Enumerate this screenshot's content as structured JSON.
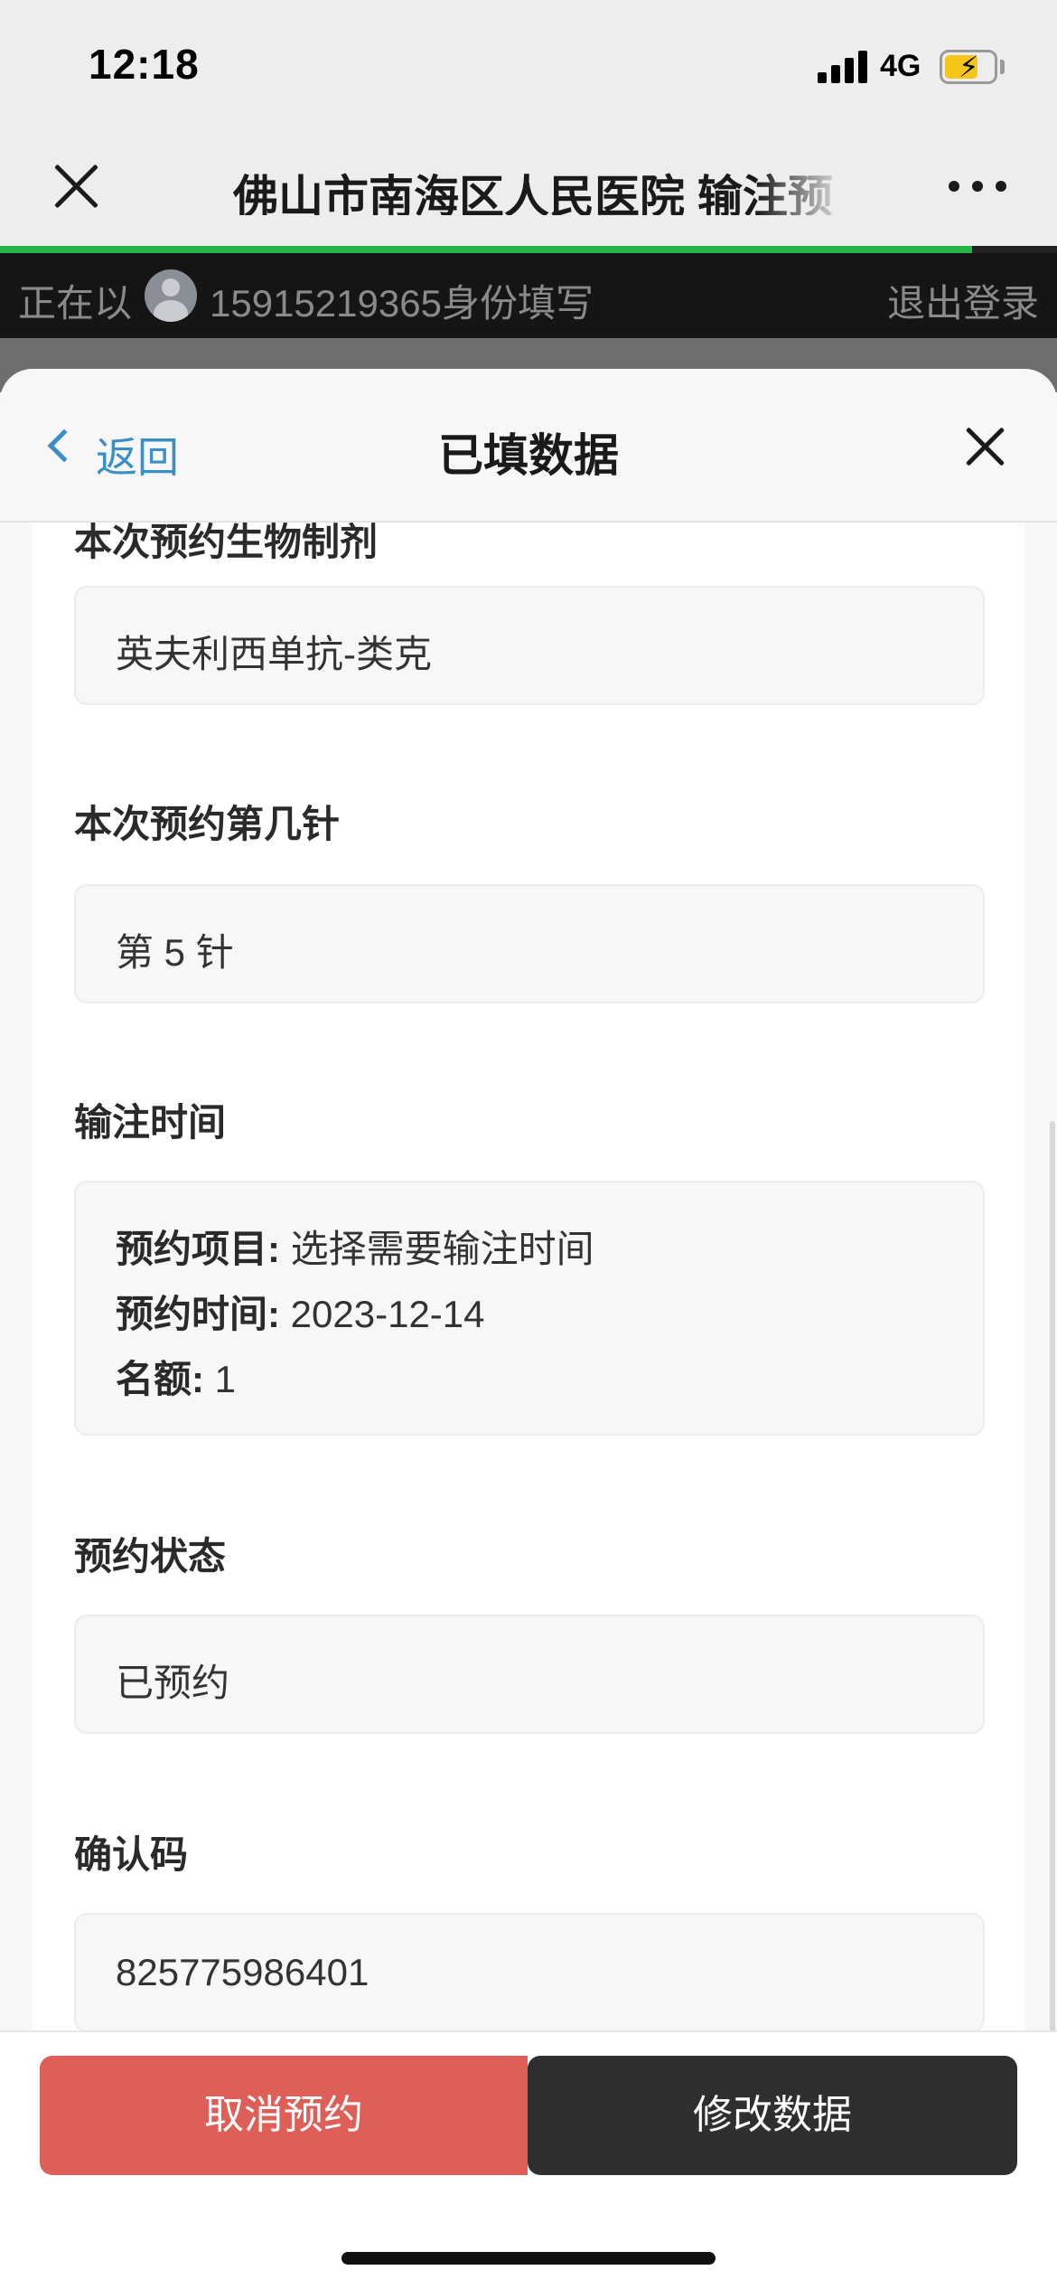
{
  "status_bar": {
    "time": "12:18",
    "network": "4G",
    "battery_icon": "battery-charging-icon",
    "signal_icon": "signal-icon"
  },
  "nav": {
    "title": "佛山市南海区人民医院  输注预",
    "close_icon": "close-icon",
    "more_icon": "more-icon"
  },
  "progress": {
    "fraction": 0.92,
    "color": "#27b54b"
  },
  "identity": {
    "prefix": "正在以",
    "text": "15915219365身份填写",
    "logout_label": "退出登录"
  },
  "sheet": {
    "back_label": "返回",
    "title": "已填数据",
    "close_icon": "close-icon"
  },
  "fields": [
    {
      "label": "本次预约生物制剂",
      "value": "英夫利西单抗-类克"
    },
    {
      "label": "本次预约第几针",
      "value": "第 5 针"
    },
    {
      "label": "输注时间",
      "rows": [
        {
          "key": "预约项目:",
          "val": "选择需要输注时间"
        },
        {
          "key": "预约时间:",
          "val": "2023-12-14"
        },
        {
          "key": "名额:",
          "val": "1"
        }
      ]
    },
    {
      "label": "预约状态",
      "value": "已预约"
    },
    {
      "label": "确认码",
      "value": "825775986401"
    }
  ],
  "actions": {
    "cancel_label": "取消预约",
    "modify_label": "修改数据",
    "cancel_color": "#de5f58",
    "modify_color": "#2f2f2f"
  }
}
